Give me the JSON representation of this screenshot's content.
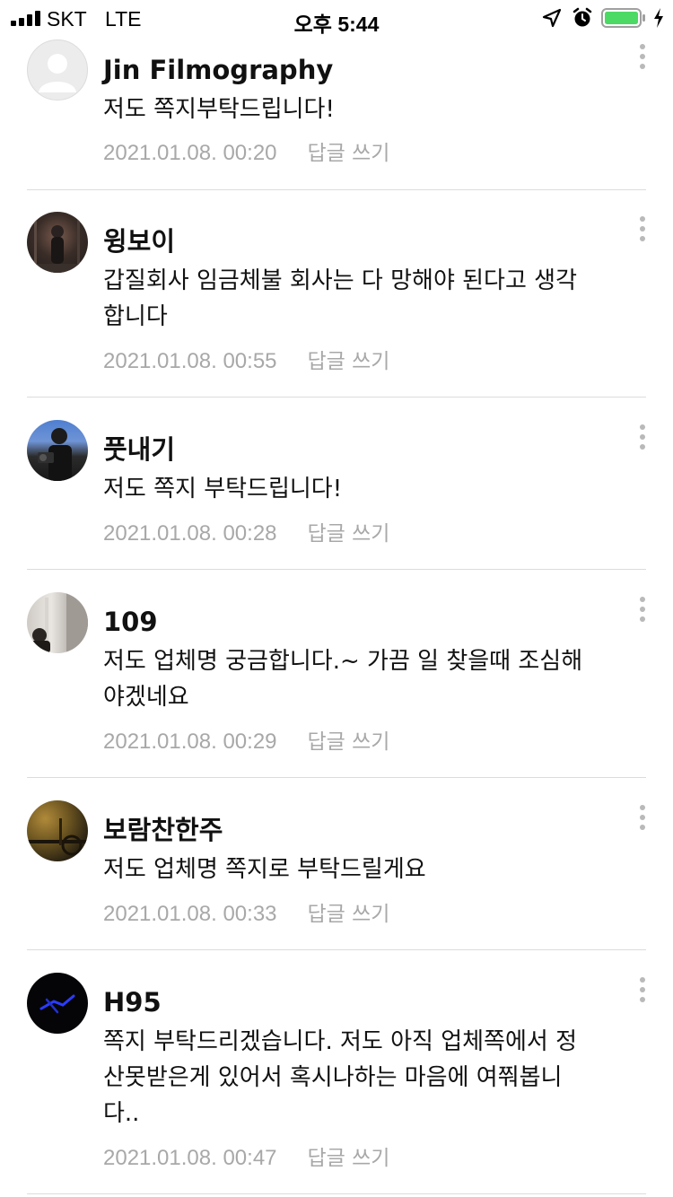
{
  "status_bar": {
    "carrier": "SKT",
    "network": "LTE",
    "time": "오후 5:44",
    "battery_color": "#4cd964"
  },
  "comments": [
    {
      "author": "Jin Filmography",
      "body": "저도 쪽지부탁드립니다!",
      "date": "2021.01.08. 00:20",
      "reply": "답글 쓰기",
      "avatar": "default-profile-icon"
    },
    {
      "author": "윙보이",
      "body": "갑질회사 임금체불 회사는 다 망해야 된다고 생각\n합니다",
      "date": "2021.01.08. 00:55",
      "reply": "답글 쓰기",
      "avatar": "photo"
    },
    {
      "author": "풋내기",
      "body": "저도 쪽지 부탁드립니다!",
      "date": "2021.01.08. 00:28",
      "reply": "답글 쓰기",
      "avatar": "photo"
    },
    {
      "author": "109",
      "body": "저도 업체명 궁금합니다.~ 가끔 일 찾을때 조심해\n야겠네요",
      "date": "2021.01.08. 00:29",
      "reply": "답글 쓰기",
      "avatar": "photo"
    },
    {
      "author": "보람찬한주",
      "body": "저도 업체명 쪽지로 부탁드릴게요",
      "date": "2021.01.08. 00:33",
      "reply": "답글 쓰기",
      "avatar": "photo"
    },
    {
      "author": "H95",
      "body": "쪽지 부탁드리겠습니다. 저도 아직 업체쪽에서 정\n산못받은게 있어서 혹시나하는 마음에 여쭤봅니\n다..",
      "date": "2021.01.08. 00:47",
      "reply": "답글 쓰기",
      "avatar": "photo"
    }
  ]
}
